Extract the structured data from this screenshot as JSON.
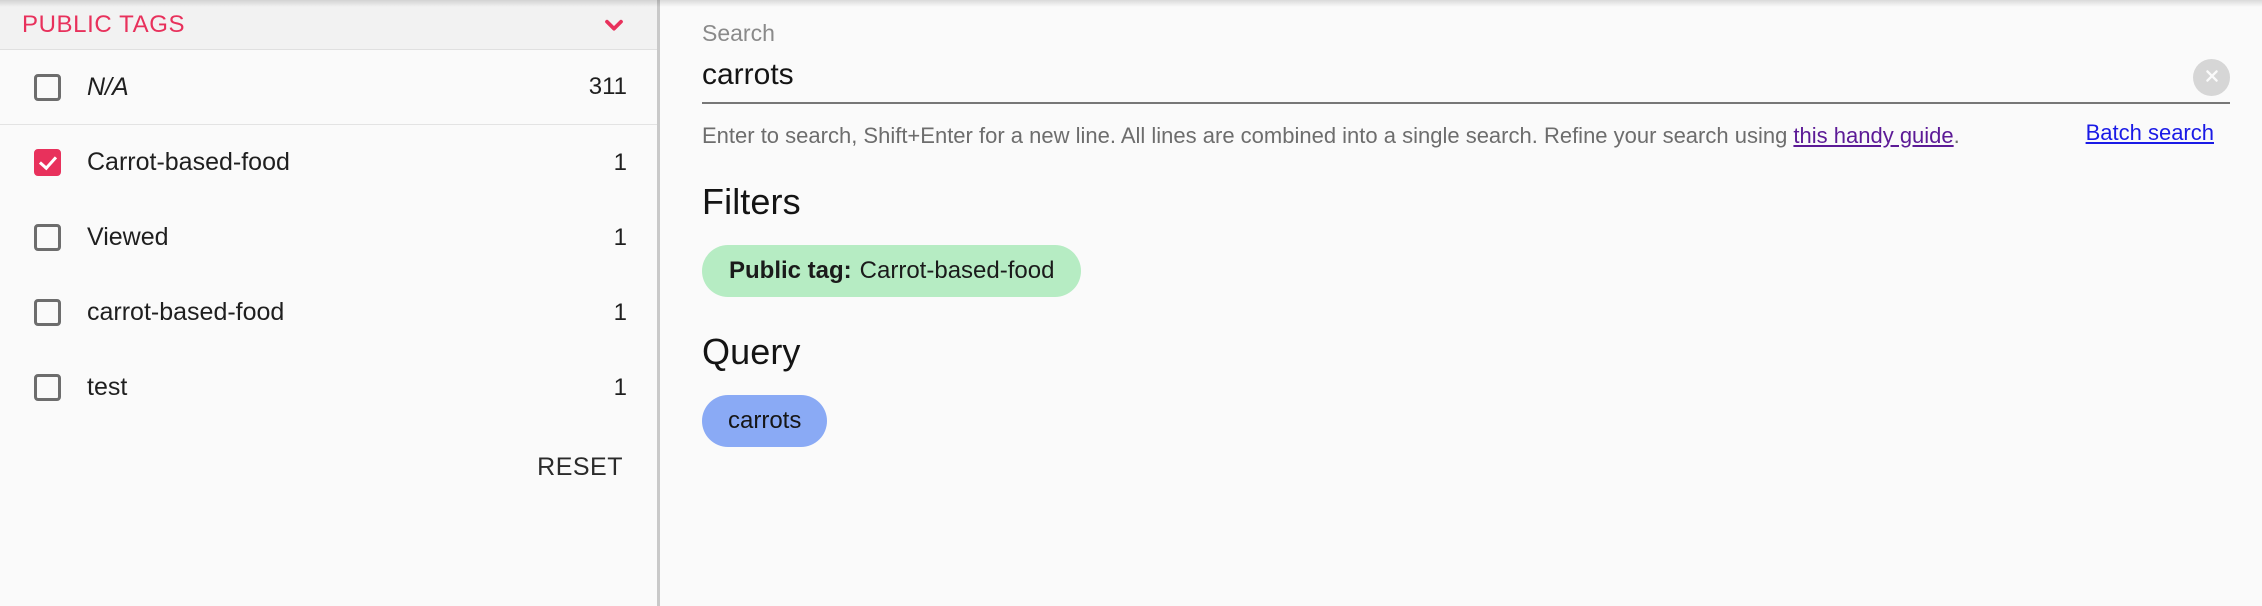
{
  "sidebar": {
    "facet": {
      "title": "PUBLIC TAGS",
      "collapse_icon": "chevron-down-icon",
      "accent_color": "#e8315c"
    },
    "rows": [
      {
        "label": "N/A",
        "count": "311",
        "checked": false,
        "italic": true,
        "divider": true
      },
      {
        "label": "Carrot-based-food",
        "count": "1",
        "checked": true,
        "italic": false,
        "divider": false
      },
      {
        "label": "Viewed",
        "count": "1",
        "checked": false,
        "italic": false,
        "divider": false
      },
      {
        "label": "carrot-based-food",
        "count": "1",
        "checked": false,
        "italic": false,
        "divider": false
      },
      {
        "label": "test",
        "count": "1",
        "checked": false,
        "italic": false,
        "divider": false
      }
    ],
    "reset_label": "RESET"
  },
  "main": {
    "search": {
      "label": "Search",
      "value": "carrots",
      "placeholder": "Search",
      "clear_icon": "close-icon"
    },
    "helper": {
      "text_before": "Enter to search, Shift+Enter for a new line. All lines are combined into a single search. Refine your search using ",
      "link_text": "this handy guide",
      "text_after": ".",
      "batch_link": "Batch search"
    },
    "filters": {
      "title": "Filters",
      "chips": [
        {
          "prefix": "Public tag:",
          "value": "Carrot-based-food",
          "color": "#b6ecc3"
        }
      ]
    },
    "query": {
      "title": "Query",
      "chips": [
        {
          "value": "carrots",
          "color": "#8aaaf5"
        }
      ]
    }
  }
}
